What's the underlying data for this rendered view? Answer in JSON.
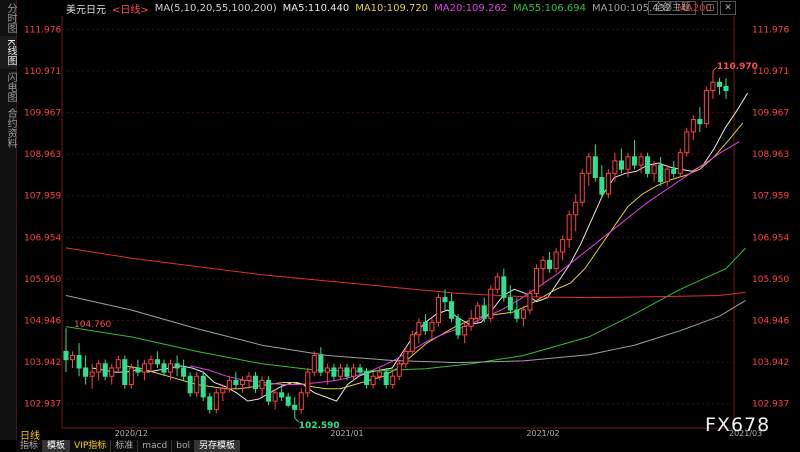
{
  "sidebar": {
    "tabs": [
      {
        "label": "分时图"
      },
      {
        "label": "K线图"
      },
      {
        "label": "闪电图"
      },
      {
        "label": "合约资料"
      }
    ]
  },
  "header": {
    "symbol": "美元日元",
    "period": "<日线>",
    "ma_params": "MA(5,10,20,55,100,200)",
    "ma5": "MA5:110.440",
    "ma10": "MA10:109.720",
    "ma20": "MA20:109.262",
    "ma55": "MA55:106.694",
    "ma100": "MA100:105.432",
    "ma200": "MA200"
  },
  "theme_button": "全部主题",
  "window_buttons": {
    "restore": "▢",
    "close": "✕"
  },
  "period_label": "日线",
  "watermark": "FX678",
  "bottom_tabs": [
    {
      "label": "指标"
    },
    {
      "label": "模板"
    },
    {
      "label": "VIP指标"
    },
    {
      "label": "标准"
    },
    {
      "label": "macd"
    },
    {
      "label": "bol"
    },
    {
      "label": "另存模板"
    }
  ],
  "colors": {
    "up": "#ff4040",
    "down": "#2fe08f",
    "ma5": "#e8e8e8",
    "ma10": "#e0d040",
    "ma20": "#e040e0",
    "ma55": "#30c030",
    "ma100": "#a0a0a0",
    "ma200": "#e03030",
    "axis": "#ff4040"
  },
  "chart_data": {
    "type": "candlestick",
    "yticks": [
      "111.976",
      "110.971",
      "109.967",
      "108.963",
      "107.959",
      "106.954",
      "105.950",
      "104.946",
      "103.942",
      "102.937"
    ],
    "ylim": [
      102.35,
      112.3
    ],
    "xticks": [
      {
        "label": "2020/12",
        "i": 10
      },
      {
        "label": "2021/01",
        "i": 43
      },
      {
        "label": "2021/02",
        "i": 73
      },
      {
        "label": "2021/03",
        "i": 104
      }
    ],
    "annotations": {
      "high": "110.970",
      "low": "102.590",
      "left": "104.760"
    },
    "candles": [
      [
        104.2,
        104.76,
        103.7,
        104.0
      ],
      [
        104.0,
        104.2,
        103.8,
        104.1
      ],
      [
        104.1,
        104.4,
        103.6,
        103.8
      ],
      [
        103.8,
        104.1,
        103.4,
        103.6
      ],
      [
        103.6,
        103.9,
        103.3,
        103.7
      ],
      [
        103.7,
        104.0,
        103.5,
        103.9
      ],
      [
        103.9,
        104.0,
        103.5,
        103.6
      ],
      [
        103.6,
        103.9,
        103.4,
        103.8
      ],
      [
        103.8,
        104.1,
        103.7,
        104.0
      ],
      [
        104.0,
        104.1,
        103.3,
        103.4
      ],
      [
        103.4,
        103.9,
        103.3,
        103.8
      ],
      [
        103.8,
        104.0,
        103.6,
        103.7
      ],
      [
        103.7,
        104.0,
        103.5,
        103.9
      ],
      [
        103.9,
        104.1,
        103.7,
        104.0
      ],
      [
        104.0,
        104.2,
        103.8,
        103.9
      ],
      [
        103.9,
        104.0,
        103.6,
        103.7
      ],
      [
        103.7,
        104.0,
        103.5,
        103.9
      ],
      [
        103.9,
        104.1,
        103.6,
        103.8
      ],
      [
        103.8,
        104.0,
        103.5,
        103.6
      ],
      [
        103.6,
        103.7,
        103.1,
        103.2
      ],
      [
        103.2,
        103.7,
        103.1,
        103.6
      ],
      [
        103.6,
        103.7,
        103.0,
        103.1
      ],
      [
        103.1,
        103.2,
        102.7,
        102.8
      ],
      [
        102.8,
        103.3,
        102.7,
        103.2
      ],
      [
        103.2,
        103.4,
        103.0,
        103.3
      ],
      [
        103.3,
        103.6,
        103.2,
        103.5
      ],
      [
        103.5,
        103.7,
        103.3,
        103.4
      ],
      [
        103.4,
        103.6,
        103.2,
        103.5
      ],
      [
        103.5,
        103.7,
        103.3,
        103.6
      ],
      [
        103.6,
        103.7,
        103.2,
        103.3
      ],
      [
        103.3,
        103.6,
        103.1,
        103.5
      ],
      [
        103.5,
        103.6,
        102.9,
        103.0
      ],
      [
        103.0,
        103.3,
        102.8,
        103.2
      ],
      [
        103.2,
        103.4,
        103.0,
        103.1
      ],
      [
        103.1,
        103.2,
        102.85,
        102.9
      ],
      [
        102.9,
        103.1,
        102.59,
        102.8
      ],
      [
        102.8,
        103.3,
        102.7,
        103.2
      ],
      [
        103.2,
        103.8,
        103.1,
        103.7
      ],
      [
        103.7,
        104.2,
        103.6,
        104.1
      ],
      [
        104.1,
        104.3,
        103.6,
        103.7
      ],
      [
        103.7,
        103.9,
        103.4,
        103.8
      ],
      [
        103.8,
        103.9,
        103.5,
        103.6
      ],
      [
        103.6,
        103.9,
        103.5,
        103.8
      ],
      [
        103.8,
        103.9,
        103.5,
        103.6
      ],
      [
        103.6,
        103.9,
        103.5,
        103.8
      ],
      [
        103.8,
        103.9,
        103.6,
        103.7
      ],
      [
        103.7,
        103.8,
        103.3,
        103.4
      ],
      [
        103.4,
        103.7,
        103.3,
        103.6
      ],
      [
        103.6,
        103.8,
        103.5,
        103.7
      ],
      [
        103.7,
        103.8,
        103.3,
        103.4
      ],
      [
        103.4,
        103.7,
        103.3,
        103.6
      ],
      [
        103.6,
        104.0,
        103.5,
        103.9
      ],
      [
        103.9,
        104.3,
        103.8,
        104.2
      ],
      [
        104.2,
        104.7,
        104.1,
        104.6
      ],
      [
        104.6,
        105.0,
        104.4,
        104.9
      ],
      [
        104.9,
        105.1,
        104.6,
        104.7
      ],
      [
        104.7,
        105.0,
        104.5,
        104.9
      ],
      [
        104.9,
        105.6,
        104.8,
        105.5
      ],
      [
        105.5,
        105.7,
        105.2,
        105.4
      ],
      [
        105.4,
        105.6,
        104.9,
        105.0
      ],
      [
        105.0,
        105.1,
        104.5,
        104.6
      ],
      [
        104.6,
        104.9,
        104.4,
        104.8
      ],
      [
        104.8,
        105.2,
        104.7,
        105.0
      ],
      [
        105.0,
        105.4,
        104.9,
        105.3
      ],
      [
        105.3,
        105.5,
        104.9,
        105.0
      ],
      [
        105.0,
        105.8,
        104.9,
        105.7
      ],
      [
        105.7,
        106.1,
        105.6,
        106.0
      ],
      [
        106.0,
        106.2,
        105.4,
        105.5
      ],
      [
        105.5,
        105.8,
        105.1,
        105.2
      ],
      [
        105.2,
        105.5,
        104.9,
        105.0
      ],
      [
        105.0,
        105.3,
        104.8,
        105.2
      ],
      [
        105.2,
        105.7,
        105.1,
        105.6
      ],
      [
        105.6,
        106.3,
        105.5,
        106.2
      ],
      [
        106.2,
        106.5,
        105.8,
        106.4
      ],
      [
        106.4,
        106.6,
        106.1,
        106.2
      ],
      [
        106.2,
        106.7,
        106.1,
        106.6
      ],
      [
        106.6,
        107.0,
        106.4,
        106.9
      ],
      [
        106.9,
        107.6,
        106.7,
        107.5
      ],
      [
        107.5,
        108.0,
        107.1,
        107.8
      ],
      [
        107.8,
        108.6,
        107.7,
        108.5
      ],
      [
        108.5,
        109.0,
        108.2,
        108.9
      ],
      [
        108.9,
        109.2,
        108.3,
        108.4
      ],
      [
        108.4,
        108.7,
        107.9,
        108.0
      ],
      [
        108.0,
        108.6,
        107.9,
        108.5
      ],
      [
        108.5,
        109.0,
        108.3,
        108.8
      ],
      [
        108.8,
        109.1,
        108.5,
        108.6
      ],
      [
        108.6,
        109.0,
        108.4,
        108.9
      ],
      [
        108.9,
        109.3,
        108.6,
        108.7
      ],
      [
        108.7,
        109.0,
        108.5,
        108.9
      ],
      [
        108.9,
        109.0,
        108.4,
        108.5
      ],
      [
        108.5,
        108.8,
        108.3,
        108.7
      ],
      [
        108.7,
        108.9,
        108.2,
        108.3
      ],
      [
        108.3,
        108.7,
        108.2,
        108.6
      ],
      [
        108.6,
        108.8,
        108.4,
        108.5
      ],
      [
        108.5,
        109.1,
        108.4,
        109.0
      ],
      [
        109.0,
        109.6,
        108.9,
        109.5
      ],
      [
        109.5,
        109.9,
        109.3,
        109.8
      ],
      [
        109.8,
        110.1,
        109.5,
        109.7
      ],
      [
        109.7,
        110.6,
        109.6,
        110.5
      ],
      [
        110.5,
        110.97,
        110.3,
        110.7
      ],
      [
        110.7,
        110.8,
        110.4,
        110.6
      ],
      [
        110.6,
        110.8,
        110.3,
        110.5
      ]
    ],
    "ma": {
      "ma5": {
        "from": 4,
        "values": [
          103.8,
          103.75,
          103.7,
          103.7,
          103.75,
          103.7,
          103.75,
          103.8,
          103.85,
          103.8,
          103.7,
          103.45,
          103.35,
          103.2,
          103.0,
          103.05,
          103.2,
          103.35,
          103.45,
          103.4,
          103.2,
          103.1,
          103.0,
          103.4,
          103.6,
          103.7,
          103.75,
          103.8,
          104.2,
          104.6,
          104.9,
          105.1,
          105.2,
          105.0,
          104.85,
          104.9,
          105.2,
          105.55,
          105.7,
          105.6,
          105.4,
          105.5,
          105.9,
          106.3,
          106.8,
          107.4,
          108.0,
          108.4,
          108.5,
          108.55,
          108.7,
          108.75,
          108.65,
          108.6,
          108.55,
          108.7,
          109.1,
          109.6,
          110.0,
          110.44
        ]
      },
      "ma10": {
        "from": 9,
        "values": [
          103.85,
          103.8,
          103.7,
          103.6,
          103.5,
          103.4,
          103.35,
          103.3,
          103.3,
          103.35,
          103.4,
          103.45,
          103.45,
          103.35,
          103.3,
          103.3,
          103.4,
          103.5,
          103.6,
          103.8,
          104.1,
          104.4,
          104.6,
          104.8,
          104.95,
          105.05,
          105.1,
          105.15,
          105.3,
          105.5,
          105.7,
          105.85,
          106.2,
          106.7,
          107.2,
          107.7,
          108.0,
          108.2,
          108.35,
          108.45,
          108.6,
          108.9,
          109.3,
          109.72
        ]
      },
      "ma20": {
        "from": 19,
        "values": [
          103.85,
          103.75,
          103.6,
          103.5,
          103.45,
          103.4,
          103.4,
          103.45,
          103.5,
          103.6,
          103.75,
          103.95,
          104.2,
          104.45,
          104.65,
          104.8,
          105.0,
          105.2,
          105.45,
          105.75,
          106.05,
          106.4,
          106.75,
          107.1,
          107.45,
          107.8,
          108.1,
          108.4,
          108.7,
          109.0,
          109.262
        ]
      },
      "ma55": {
        "points": [
          [
            0,
            104.8
          ],
          [
            10,
            104.55
          ],
          [
            20,
            104.2
          ],
          [
            30,
            103.9
          ],
          [
            38,
            103.75
          ],
          [
            45,
            103.72
          ],
          [
            55,
            103.78
          ],
          [
            62,
            103.9
          ],
          [
            70,
            104.1
          ],
          [
            80,
            104.55
          ],
          [
            87,
            105.1
          ],
          [
            94,
            105.7
          ],
          [
            101,
            106.2
          ],
          [
            104,
            106.694
          ]
        ]
      },
      "ma100": {
        "points": [
          [
            0,
            105.55
          ],
          [
            10,
            105.2
          ],
          [
            20,
            104.75
          ],
          [
            30,
            104.35
          ],
          [
            40,
            104.1
          ],
          [
            50,
            103.98
          ],
          [
            60,
            103.93
          ],
          [
            70,
            103.97
          ],
          [
            80,
            104.12
          ],
          [
            87,
            104.35
          ],
          [
            94,
            104.7
          ],
          [
            100,
            105.05
          ],
          [
            104,
            105.432
          ]
        ]
      },
      "ma200": {
        "points": [
          [
            0,
            106.7
          ],
          [
            10,
            106.45
          ],
          [
            20,
            106.25
          ],
          [
            30,
            106.05
          ],
          [
            40,
            105.9
          ],
          [
            50,
            105.75
          ],
          [
            60,
            105.6
          ],
          [
            70,
            105.52
          ],
          [
            80,
            105.5
          ],
          [
            90,
            105.52
          ],
          [
            100,
            105.55
          ],
          [
            104,
            105.63
          ]
        ]
      }
    }
  }
}
